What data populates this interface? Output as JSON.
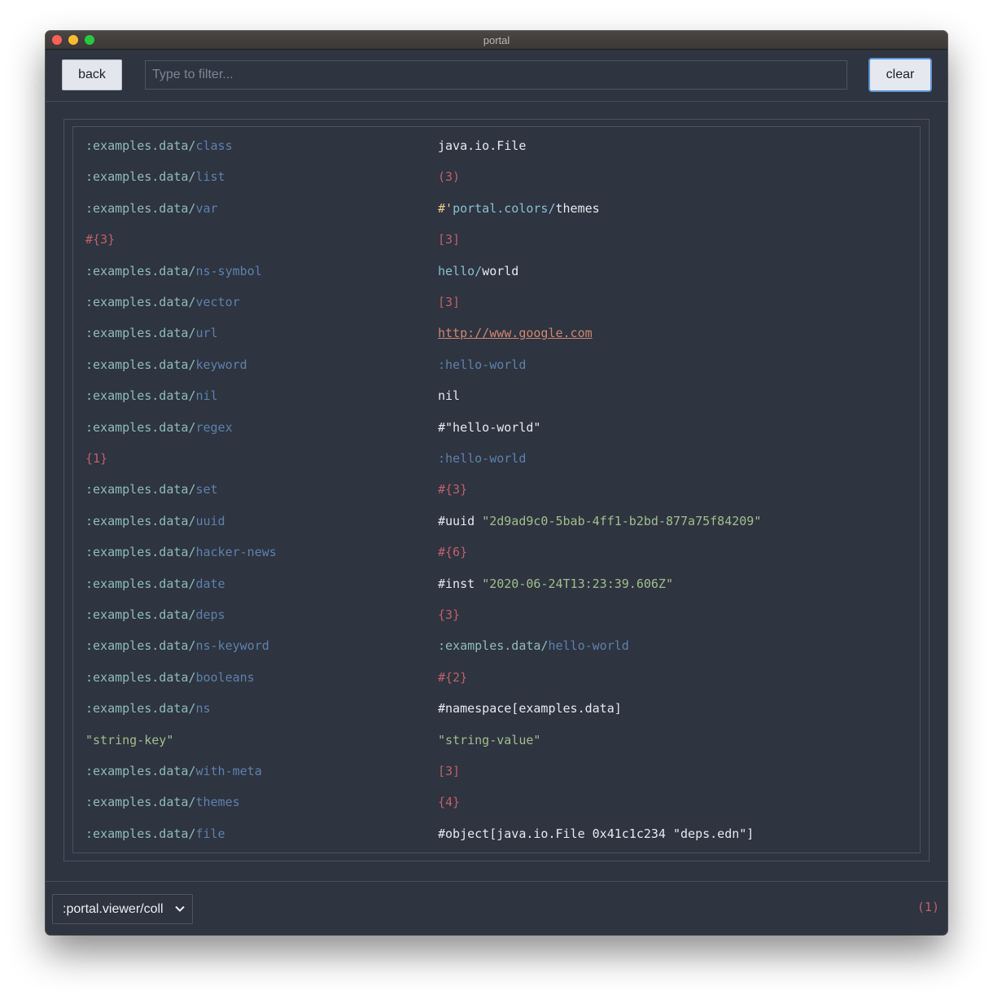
{
  "window": {
    "title": "portal"
  },
  "toolbar": {
    "back_label": "back",
    "filter_placeholder": "Type to filter...",
    "filter_value": "",
    "clear_label": "clear"
  },
  "rows": [
    {
      "key": [
        [
          ":examples.data/",
          "ns"
        ],
        [
          "class",
          "kw"
        ]
      ],
      "value": [
        [
          "java.io.File",
          "sym"
        ]
      ]
    },
    {
      "key": [
        [
          ":examples.data/",
          "ns"
        ],
        [
          "list",
          "kw"
        ]
      ],
      "value": [
        [
          "(3)",
          "coll"
        ]
      ]
    },
    {
      "key": [
        [
          ":examples.data/",
          "ns"
        ],
        [
          "var",
          "kw"
        ]
      ],
      "value": [
        [
          "#'",
          "tag"
        ],
        [
          "portal.colors/",
          "nsym"
        ],
        [
          "themes",
          "sym"
        ]
      ]
    },
    {
      "key": [
        [
          "#{3}",
          "coll"
        ]
      ],
      "value": [
        [
          "[3]",
          "coll"
        ]
      ]
    },
    {
      "key": [
        [
          ":examples.data/",
          "ns"
        ],
        [
          "ns-symbol",
          "kw"
        ]
      ],
      "value": [
        [
          "hello/",
          "nsym"
        ],
        [
          "world",
          "sym"
        ]
      ]
    },
    {
      "key": [
        [
          ":examples.data/",
          "ns"
        ],
        [
          "vector",
          "kw"
        ]
      ],
      "value": [
        [
          "[3]",
          "coll"
        ]
      ]
    },
    {
      "key": [
        [
          ":examples.data/",
          "ns"
        ],
        [
          "url",
          "kw"
        ]
      ],
      "value": [
        [
          "http://www.google.com",
          "url"
        ]
      ]
    },
    {
      "key": [
        [
          ":examples.data/",
          "ns"
        ],
        [
          "keyword",
          "kw"
        ]
      ],
      "value": [
        [
          ":hello-world",
          "kw"
        ]
      ]
    },
    {
      "key": [
        [
          ":examples.data/",
          "ns"
        ],
        [
          "nil",
          "kw"
        ]
      ],
      "value": [
        [
          "nil",
          "sym"
        ]
      ]
    },
    {
      "key": [
        [
          ":examples.data/",
          "ns"
        ],
        [
          "regex",
          "kw"
        ]
      ],
      "value": [
        [
          "#\"hello-world\"",
          "sym"
        ]
      ]
    },
    {
      "key": [
        [
          "{1}",
          "coll"
        ]
      ],
      "value": [
        [
          ":hello-world",
          "kw"
        ]
      ]
    },
    {
      "key": [
        [
          ":examples.data/",
          "ns"
        ],
        [
          "set",
          "kw"
        ]
      ],
      "value": [
        [
          "#{3}",
          "coll"
        ]
      ]
    },
    {
      "key": [
        [
          ":examples.data/",
          "ns"
        ],
        [
          "uuid",
          "kw"
        ]
      ],
      "value": [
        [
          "#uuid ",
          "sym"
        ],
        [
          "\"2d9ad9c0-5bab-4ff1-b2bd-877a75f84209\"",
          "str"
        ]
      ]
    },
    {
      "key": [
        [
          ":examples.data/",
          "ns"
        ],
        [
          "hacker-news",
          "kw"
        ]
      ],
      "value": [
        [
          "#{6}",
          "coll"
        ]
      ]
    },
    {
      "key": [
        [
          ":examples.data/",
          "ns"
        ],
        [
          "date",
          "kw"
        ]
      ],
      "value": [
        [
          "#inst ",
          "sym"
        ],
        [
          "\"2020-06-24T13:23:39.606Z\"",
          "str"
        ]
      ]
    },
    {
      "key": [
        [
          ":examples.data/",
          "ns"
        ],
        [
          "deps",
          "kw"
        ]
      ],
      "value": [
        [
          "{3}",
          "coll"
        ]
      ]
    },
    {
      "key": [
        [
          ":examples.data/",
          "ns"
        ],
        [
          "ns-keyword",
          "kw"
        ]
      ],
      "value": [
        [
          ":examples.data/",
          "ns"
        ],
        [
          "hello-world",
          "kw"
        ]
      ]
    },
    {
      "key": [
        [
          ":examples.data/",
          "ns"
        ],
        [
          "booleans",
          "kw"
        ]
      ],
      "value": [
        [
          "#{2}",
          "coll"
        ]
      ]
    },
    {
      "key": [
        [
          ":examples.data/",
          "ns"
        ],
        [
          "ns",
          "kw"
        ]
      ],
      "value": [
        [
          "#namespace[examples.data]",
          "sym"
        ]
      ]
    },
    {
      "key": [
        [
          "\"string-key\"",
          "str"
        ]
      ],
      "value": [
        [
          "\"string-value\"",
          "str"
        ]
      ]
    },
    {
      "key": [
        [
          ":examples.data/",
          "ns"
        ],
        [
          "with-meta",
          "kw"
        ]
      ],
      "value": [
        [
          "[3]",
          "coll"
        ]
      ]
    },
    {
      "key": [
        [
          ":examples.data/",
          "ns"
        ],
        [
          "themes",
          "kw"
        ]
      ],
      "value": [
        [
          "{4}",
          "coll"
        ]
      ]
    },
    {
      "key": [
        [
          ":examples.data/",
          "ns"
        ],
        [
          "file",
          "kw"
        ]
      ],
      "value": [
        [
          "#object[java.io.File 0x41c1c234 \"deps.edn\"]",
          "sym"
        ]
      ]
    }
  ],
  "footer": {
    "viewer_selected": ":portal.viewer/coll",
    "count": "(1)"
  },
  "colors": {
    "background": "#2e3440",
    "namespace": "#8fbcbb",
    "keyword": "#5e81ac",
    "string": "#a3be8c",
    "collection": "#bf616a",
    "symbol": "#e5e9f0",
    "url": "#d08770",
    "focus_ring": "#5d93d6"
  }
}
